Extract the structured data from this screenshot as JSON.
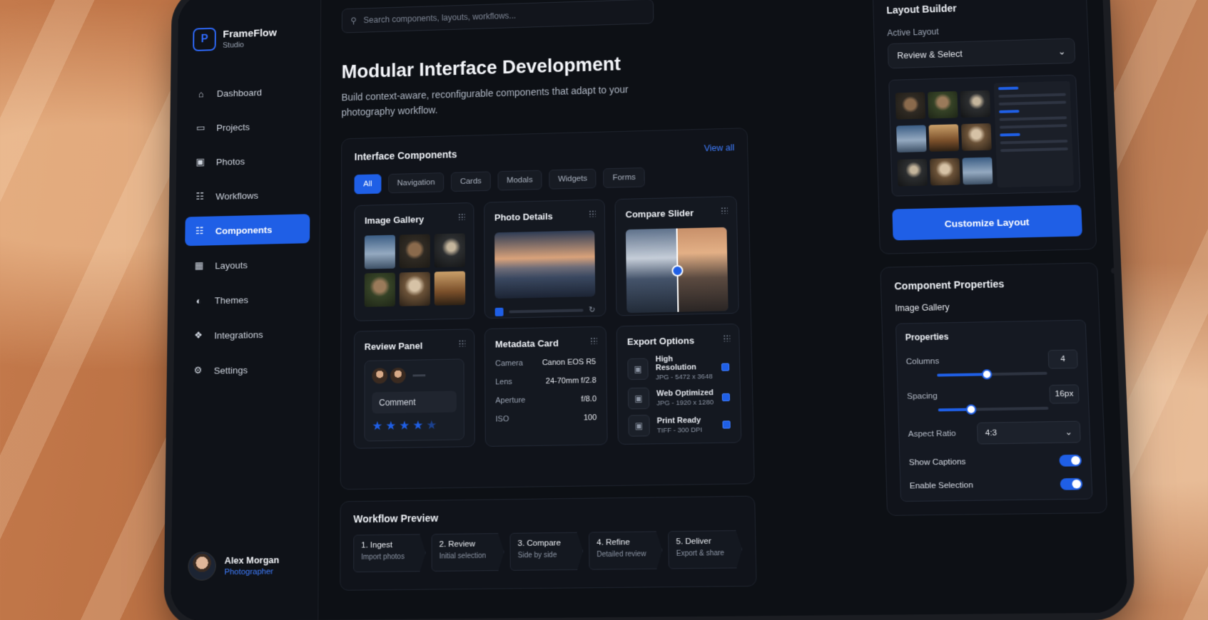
{
  "brand": {
    "name": "FrameFlow",
    "sub": "Studio"
  },
  "search": {
    "placeholder": "Search components, layouts, workflows..."
  },
  "nav": [
    {
      "label": "Dashboard",
      "icon": "home-icon"
    },
    {
      "label": "Projects",
      "icon": "folder-icon"
    },
    {
      "label": "Photos",
      "icon": "image-icon"
    },
    {
      "label": "Workflows",
      "icon": "workflow-icon"
    },
    {
      "label": "Components",
      "icon": "components-icon",
      "active": true
    },
    {
      "label": "Layouts",
      "icon": "layout-icon"
    },
    {
      "label": "Themes",
      "icon": "palette-icon"
    },
    {
      "label": "Integrations",
      "icon": "puzzle-icon"
    },
    {
      "label": "Settings",
      "icon": "gear-icon"
    }
  ],
  "user": {
    "name": "Alex Morgan",
    "role": "Photographer"
  },
  "hero": {
    "title": "Modular Interface Development",
    "subtitle": "Build context-aware, reconfigurable components that adapt to your photography workflow."
  },
  "library": {
    "title": "Interface Components",
    "view_all": "View all",
    "chips": [
      "All",
      "Navigation",
      "Cards",
      "Modals",
      "Widgets",
      "Forms"
    ],
    "cards": {
      "gallery": "Image Gallery",
      "details": "Photo Details",
      "compare": "Compare Slider",
      "review": "Review Panel",
      "metadata": "Metadata Card",
      "export": "Export Options"
    },
    "review": {
      "comment": "Comment",
      "rating": 4.5
    },
    "metadata": [
      {
        "k": "Camera",
        "v": "Canon EOS R5"
      },
      {
        "k": "Lens",
        "v": "24-70mm f/2.8"
      },
      {
        "k": "Aperture",
        "v": "f/8.0"
      },
      {
        "k": "ISO",
        "v": "100"
      }
    ],
    "export": [
      {
        "t": "High Resolution",
        "s": "JPG - 5472 x 3648"
      },
      {
        "t": "Web Optimized",
        "s": "JPG - 1920 x 1280"
      },
      {
        "t": "Print Ready",
        "s": "TIFF - 300 DPI"
      }
    ]
  },
  "workflow": {
    "title": "Workflow Preview",
    "steps": [
      {
        "t": "1. Ingest",
        "s": "Import photos"
      },
      {
        "t": "2. Review",
        "s": "Initial selection"
      },
      {
        "t": "3. Compare",
        "s": "Side by side"
      },
      {
        "t": "4. Refine",
        "s": "Detailed review"
      },
      {
        "t": "5. Deliver",
        "s": "Export & share"
      }
    ]
  },
  "layout_builder": {
    "title": "Layout Builder",
    "active_label": "Active Layout",
    "active_value": "Review & Select",
    "button": "Customize Layout"
  },
  "properties": {
    "title": "Component Properties",
    "component": "Image Gallery",
    "section": "Properties",
    "columns_label": "Columns",
    "columns_value": "4",
    "columns_fill": 0.45,
    "spacing_label": "Spacing",
    "spacing_value": "16px",
    "spacing_fill": 0.3,
    "aspect_label": "Aspect Ratio",
    "aspect_value": "4:3",
    "captions_label": "Show Captions",
    "selection_label": "Enable Selection"
  },
  "colors": {
    "accent": "#1f5fe6",
    "bg": "#0d1015"
  }
}
